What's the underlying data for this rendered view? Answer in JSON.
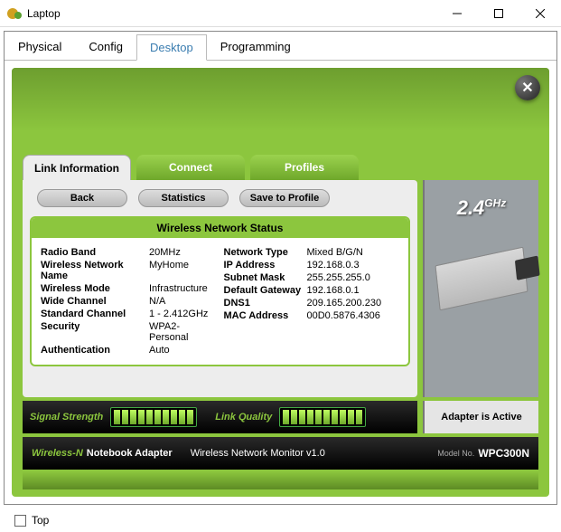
{
  "window": {
    "title": "Laptop"
  },
  "outer_tabs": {
    "physical": "Physical",
    "config": "Config",
    "desktop": "Desktop",
    "programming": "Programming"
  },
  "inner_tabs": {
    "link_info": "Link Information",
    "connect": "Connect",
    "profiles": "Profiles"
  },
  "actions": {
    "back": "Back",
    "statistics": "Statistics",
    "save_profile": "Save to Profile"
  },
  "status_header": "Wireless Network Status",
  "left_fields": [
    {
      "label": "Radio Band",
      "value": "20MHz"
    },
    {
      "label": "Wireless Network Name",
      "value": "MyHome"
    },
    {
      "label": "Wireless Mode",
      "value": "Infrastructure"
    },
    {
      "label": "Wide Channel",
      "value": "N/A"
    },
    {
      "label": "Standard Channel",
      "value": "1 - 2.412GHz"
    },
    {
      "label": "Security",
      "value": "WPA2-Personal"
    },
    {
      "label": "Authentication",
      "value": "Auto"
    }
  ],
  "right_fields": [
    {
      "label": "Network Type",
      "value": "Mixed B/G/N"
    },
    {
      "label": "IP Address",
      "value": "192.168.0.3"
    },
    {
      "label": "Subnet Mask",
      "value": "255.255.255.0"
    },
    {
      "label": "Default Gateway",
      "value": "192.168.0.1"
    },
    {
      "label": "DNS1",
      "value": "209.165.200.230"
    },
    {
      "label": "MAC Address",
      "value": "00D0.5876.4306"
    }
  ],
  "ghz_label": "2.4",
  "ghz_unit": "GHz",
  "signal_strength_label": "Signal Strength",
  "link_quality_label": "Link Quality",
  "adapter_status": "Adapter is Active",
  "wireless_n": "Wireless-N",
  "adapter_type": "Notebook Adapter",
  "monitor_label": "Wireless Network Monitor  v1.0",
  "model_prefix": "Model No.",
  "model_no": "WPC300N",
  "top_checkbox_label": "Top"
}
